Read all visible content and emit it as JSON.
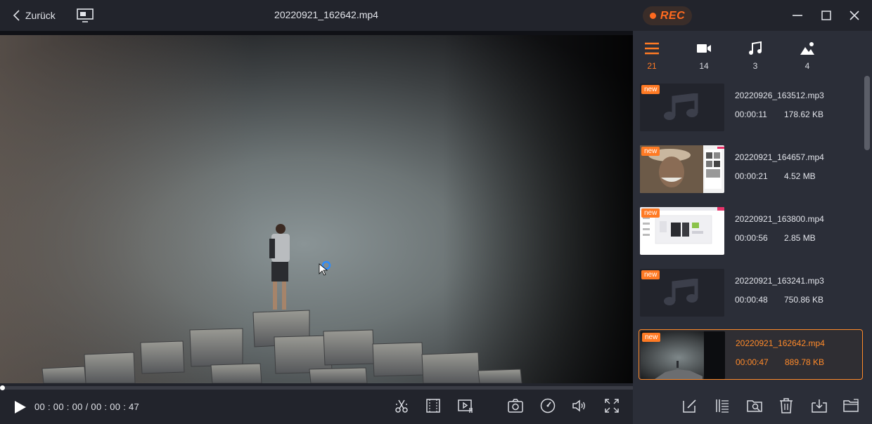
{
  "header": {
    "back_label": "Zurück",
    "file_title": "20220921_162642.mp4",
    "rec_label": "REC"
  },
  "player": {
    "current_time": "00 : 00 : 00",
    "separator": "/",
    "total_time": "00 : 00 : 47",
    "progress_fraction": 0.0
  },
  "filters": [
    {
      "icon": "list-icon",
      "count": "21",
      "active": true
    },
    {
      "icon": "video-camera-icon",
      "count": "14",
      "active": false
    },
    {
      "icon": "music-note-icon",
      "count": "3",
      "active": false
    },
    {
      "icon": "image-icon",
      "count": "4",
      "active": false
    }
  ],
  "recordings": [
    {
      "badge": "new",
      "name": "20220926_163512.mp3",
      "duration": "00:00:11",
      "size": "178.62 KB",
      "kind": "audio"
    },
    {
      "badge": "new",
      "name": "20220921_164657.mp4",
      "duration": "00:00:21",
      "size": "4.52 MB",
      "kind": "video-portrait"
    },
    {
      "badge": "new",
      "name": "20220921_163800.mp4",
      "duration": "00:00:56",
      "size": "2.85 MB",
      "kind": "video-screen"
    },
    {
      "badge": "new",
      "name": "20220921_163241.mp3",
      "duration": "00:00:48",
      "size": "750.86 KB",
      "kind": "audio"
    },
    {
      "badge": "new",
      "name": "20220921_162642.mp4",
      "duration": "00:00:47",
      "size": "889.78 KB",
      "kind": "video-scene",
      "selected": true
    }
  ],
  "colors": {
    "accent": "#ff7a24",
    "panel": "#2b2e38",
    "background": "#22242c"
  }
}
